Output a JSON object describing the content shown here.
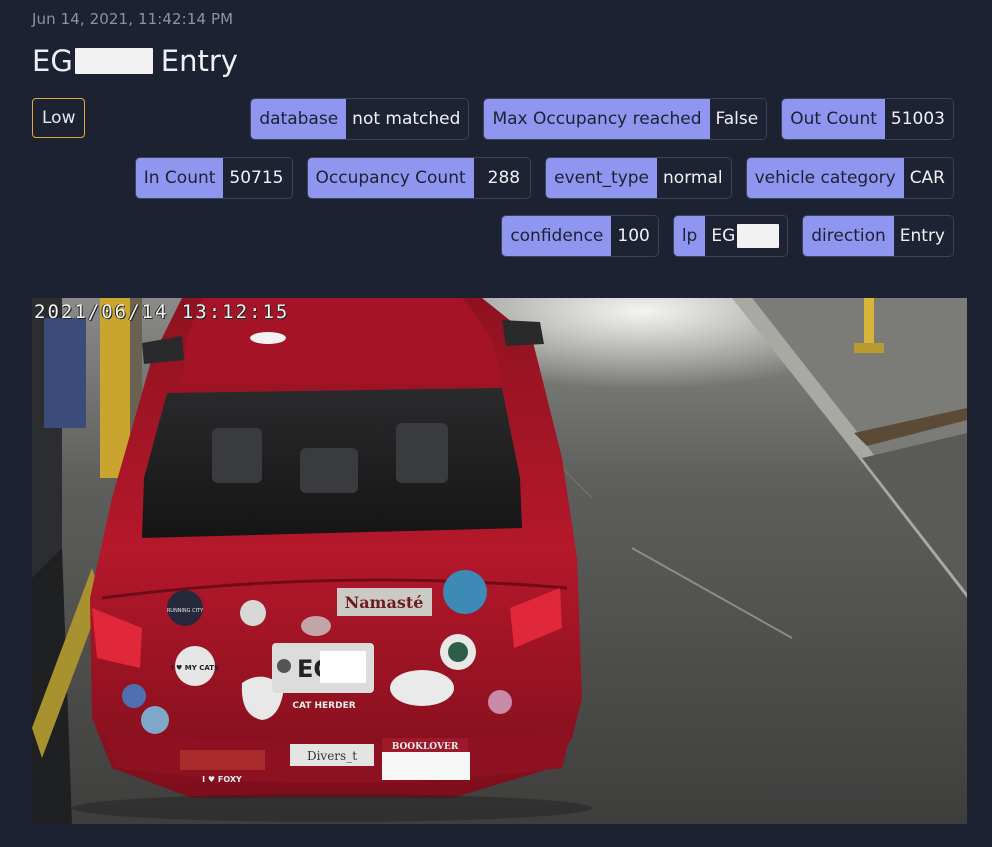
{
  "event": {
    "timestamp": "Jun 14, 2021, 11:42:14 PM",
    "plate_prefix": "EG",
    "direction_word": "Entry",
    "severity": "Low"
  },
  "tags": {
    "row1": [
      {
        "key": "database",
        "value": "not matched"
      },
      {
        "key": "Max Occupancy reached",
        "value": "False"
      },
      {
        "key": "Out Count",
        "value": "51003"
      }
    ],
    "row2": [
      {
        "key": "In Count",
        "value": "50715"
      },
      {
        "key": "Occupancy Count",
        "value": "288"
      },
      {
        "key": "event_type",
        "value": "normal"
      },
      {
        "key": "vehicle category",
        "value": "CAR"
      }
    ],
    "row3": [
      {
        "key": "confidence",
        "value": "100"
      },
      {
        "key": "lp",
        "value": "EG"
      },
      {
        "key": "direction",
        "value": "Entry"
      }
    ]
  },
  "camera": {
    "overlay_timestamp": "2021/06/14 13:12:15",
    "stickers": {
      "namaste": "Namasté",
      "i_love_my_cats": "I ♥ MY CATS",
      "cat_herder": "CAT HERDER",
      "diverse": "Divers_t",
      "booklover": "BOOKLOVER",
      "foxy": "I ♥ FOXY",
      "running_city": "RUNNING CITY",
      "plate_prefix": "EG"
    }
  },
  "colors": {
    "background": "#1c2232",
    "tag_key": "#8f96f0",
    "severity_border": "#e7a63a",
    "car_red": "#b3162a"
  }
}
